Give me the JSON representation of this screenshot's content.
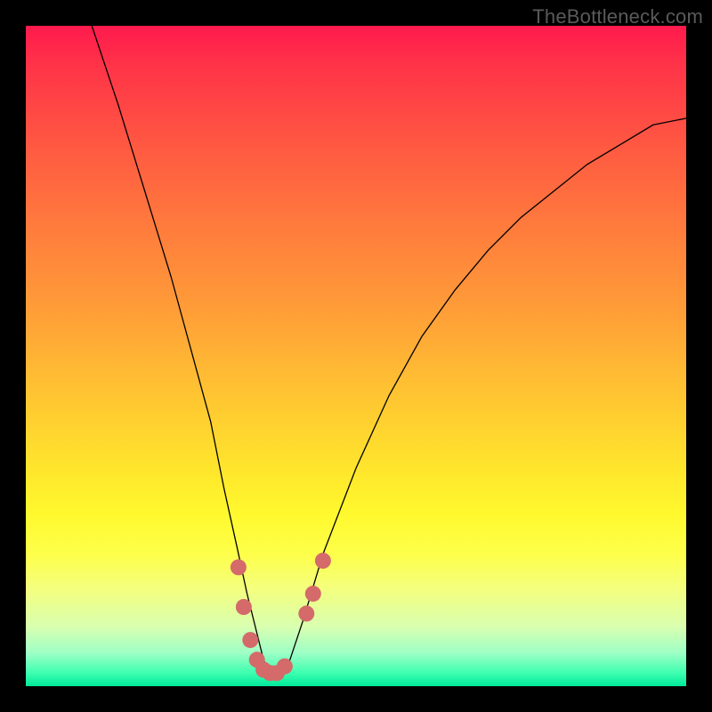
{
  "watermark": "TheBottleneck.com",
  "chart_data": {
    "type": "line",
    "title": "",
    "xlabel": "",
    "ylabel": "",
    "xlim": [
      0,
      100
    ],
    "ylim": [
      0,
      100
    ],
    "grid": false,
    "legend": false,
    "series": [
      {
        "name": "bottleneck-curve",
        "x": [
          10,
          14,
          18,
          22,
          25,
          28,
          30,
          32,
          33.5,
          35,
          36,
          37,
          38,
          39,
          40,
          42,
          45,
          50,
          55,
          60,
          65,
          70,
          75,
          80,
          85,
          90,
          95,
          100
        ],
        "y": [
          100,
          88,
          75,
          62,
          51,
          40,
          30,
          21,
          14,
          8,
          4,
          2,
          1.5,
          2,
          4,
          10,
          20,
          33,
          44,
          53,
          60,
          66,
          71,
          75,
          79,
          82,
          85,
          86
        ],
        "color": "#000000",
        "linewidth": 1.3
      }
    ],
    "markers": {
      "name": "highlight-dots",
      "color": "#d46a6a",
      "points": [
        {
          "x": 32.2,
          "y": 18
        },
        {
          "x": 33.0,
          "y": 12
        },
        {
          "x": 34.0,
          "y": 7
        },
        {
          "x": 35.0,
          "y": 4
        },
        {
          "x": 36.0,
          "y": 2.5
        },
        {
          "x": 37.0,
          "y": 2
        },
        {
          "x": 38.0,
          "y": 2
        },
        {
          "x": 39.2,
          "y": 3
        },
        {
          "x": 42.5,
          "y": 11
        },
        {
          "x": 43.5,
          "y": 14
        },
        {
          "x": 45.0,
          "y": 19
        }
      ]
    }
  }
}
